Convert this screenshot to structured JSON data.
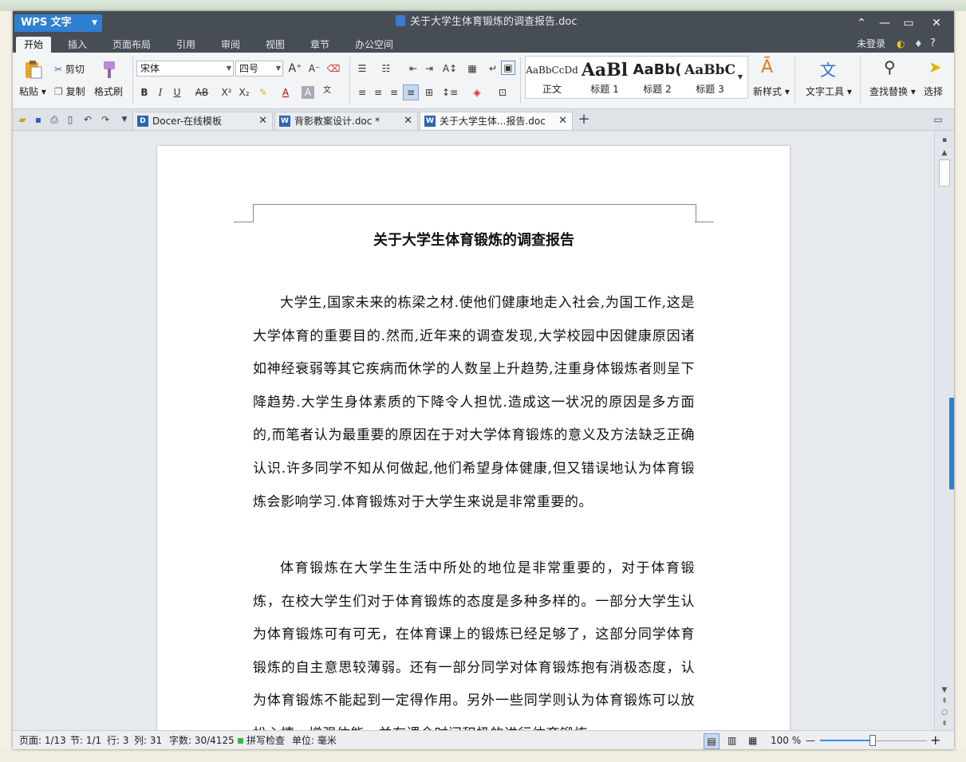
{
  "window": {
    "app_name": "WPS 文字",
    "doc_title": "关于大学生体育锻炼的调查报告.doc",
    "controls": [
      "⌃",
      "—",
      "▭",
      "✕"
    ]
  },
  "menu": {
    "tabs": [
      "开始",
      "插入",
      "页面布局",
      "引用",
      "审阅",
      "视图",
      "章节",
      "办公空间"
    ],
    "active": "开始",
    "login": "未登录",
    "help": "?"
  },
  "ribbon": {
    "paste": "粘贴",
    "cut": "剪切",
    "copy": "复制",
    "format_painter": "格式刷",
    "font_name": "宋体",
    "font_size": "四号",
    "styles": [
      {
        "sample": "AaBbCcDd",
        "label": "正文"
      },
      {
        "sample": "AaBl",
        "label": "标题 1"
      },
      {
        "sample": "AaBb(",
        "label": "标题 2"
      },
      {
        "sample": "AaBbC",
        "label": "标题 3"
      }
    ],
    "new_style": "新样式",
    "text_tools": "文字工具",
    "find_replace": "查找替换",
    "select": "选择"
  },
  "doc_tabs": [
    {
      "label": "Docer-在线模板",
      "active": false
    },
    {
      "label": "背影教案设计.doc *",
      "active": false
    },
    {
      "label": "关于大学生体...报告.doc",
      "active": true
    }
  ],
  "document": {
    "heading": "关于大学生体育锻炼的调查报告",
    "paragraphs": [
      "大学生,国家未来的栋梁之材.使他们健康地走入社会,为国工作,这是大学体育的重要目的.然而,近年来的调查发现,大学校园中因健康原因诸如神经衰弱等其它疾病而休学的人数呈上升趋势,注重身体锻炼者则呈下降趋势.大学生身体素质的下降令人担忧.造成这一状况的原因是多方面的,而笔者认为最重要的原因在于对大学体育锻炼的意义及方法缺乏正确认识.许多同学不知从何做起,他们希望身体健康,但又错误地认为体育锻炼会影响学习.体育锻炼对于大学生来说是非常重要的。",
      "体育锻炼在大学生生活中所处的地位是非常重要的，对于体育锻炼，在校大学生们对于体育锻炼的态度是多种多样的。一部分大学生认为体育锻炼可有可无，在体育课上的锻炼已经足够了，这部分同学体育锻炼的自主意思较薄弱。还有一部分同学对体育锻炼抱有消极态度，认为体育锻炼不能起到一定得作用。另外一些同学则认为体育锻炼可以放松心情、增强体能，并有课余时间积极的进行体育锻炼"
    ]
  },
  "status": {
    "page": "页面: 1/13",
    "section": "节: 1/1",
    "row": "行: 3",
    "col": "列: 31",
    "word_count": "字数: 30/4125",
    "spell_check": "拼写检查",
    "unit": "单位: 毫米",
    "zoom": "100 %",
    "zoom_level": 0.5
  },
  "colors": {
    "title_bar": "#474d55",
    "accent": "#2f7fd3",
    "spell_ok": "#3bb54a"
  }
}
